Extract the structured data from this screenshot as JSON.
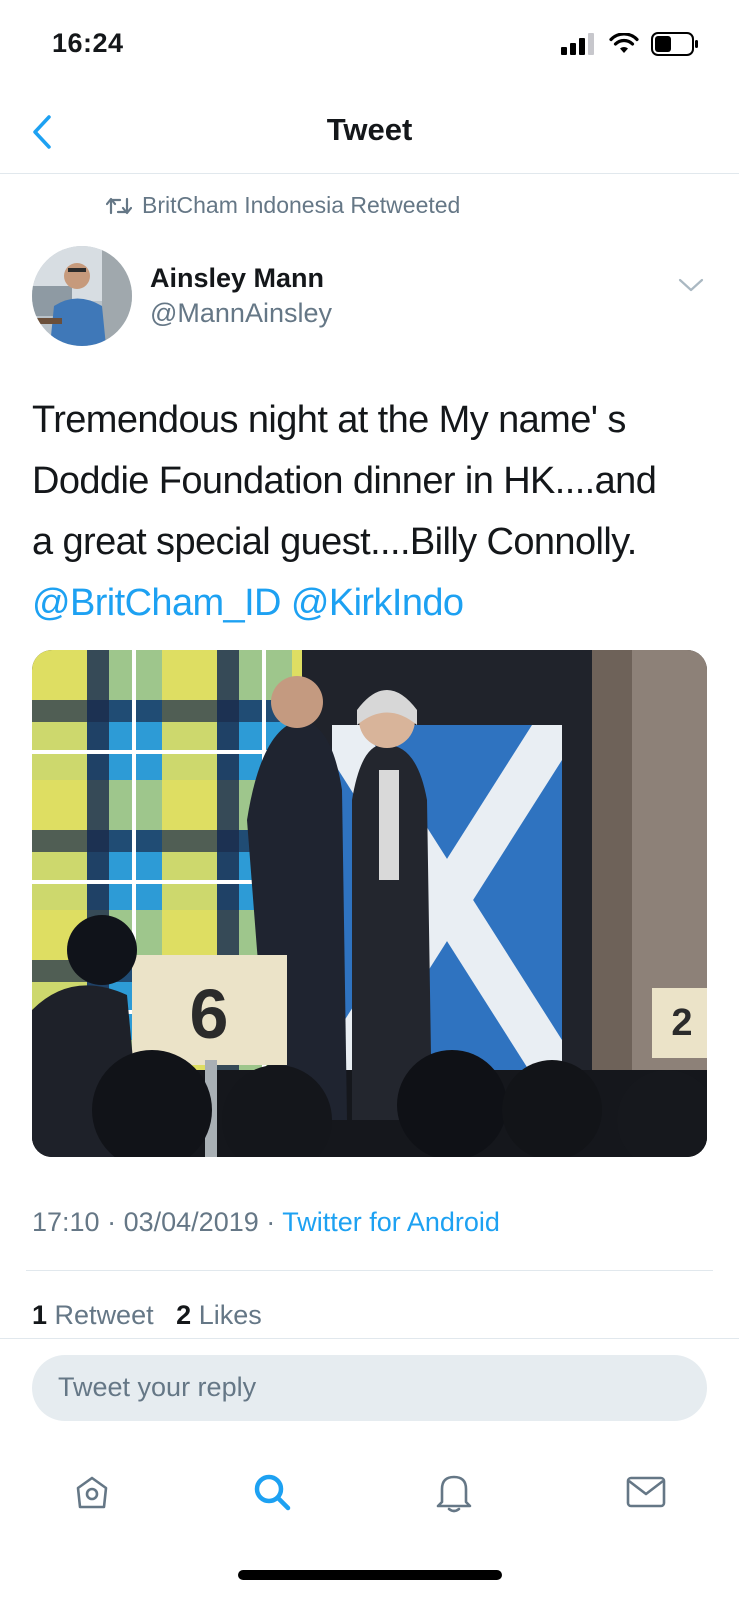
{
  "status_bar": {
    "time": "16:24",
    "icons": [
      "signal-icon",
      "wifi-icon",
      "battery-icon"
    ]
  },
  "nav": {
    "title": "Tweet",
    "back_icon": "chevron-left-icon"
  },
  "retweet_context": {
    "icon": "retweet-icon",
    "text": "BritCham Indonesia Retweeted"
  },
  "tweet": {
    "author_name": "Ainsley Mann",
    "author_handle": "@MannAinsley",
    "text_line1": "Tremendous night at the My name' s",
    "text_line2": "Doddie Foundation dinner in HK....and",
    "text_line3": "a great special guest....Billy Connolly.",
    "mention1": "@BritCham_ID",
    "mention2": "@KirkIndo",
    "media_table_number": "6",
    "media_table_number_2": "2",
    "time": "17:10",
    "date": "03/04/2019",
    "source": "Twitter for Android",
    "separator": "·"
  },
  "stats": {
    "retweets_count": "1",
    "retweets_label": "Retweet",
    "likes_count": "2",
    "likes_label": "Likes"
  },
  "reply": {
    "placeholder": "Tweet your reply"
  },
  "tab_bar": [
    {
      "name": "home",
      "icon": "home-icon",
      "active": false
    },
    {
      "name": "search",
      "icon": "search-icon",
      "active": true
    },
    {
      "name": "notifications",
      "icon": "bell-icon",
      "active": false
    },
    {
      "name": "messages",
      "icon": "mail-icon",
      "active": false
    }
  ],
  "colors": {
    "accent": "#1da1f2",
    "secondary_text": "#657786",
    "primary_text": "#14171a",
    "divider": "#e1e8ed",
    "reply_bg": "#e6ecf0"
  }
}
